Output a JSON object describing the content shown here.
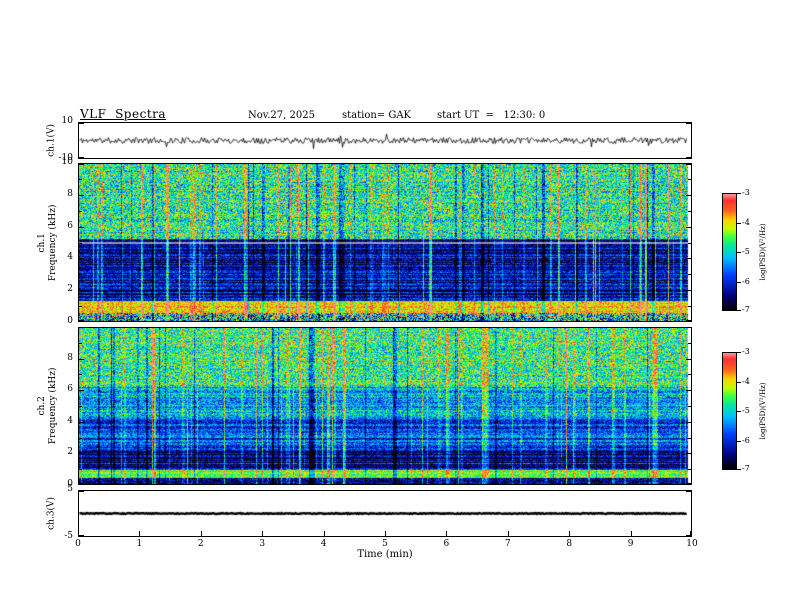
{
  "header": {
    "title": "VLF  Spectra",
    "date": "Nov.27, 2025",
    "station_label": "station= GAK",
    "start_ut_label": "start UT  =   12:30: 0"
  },
  "xaxis": {
    "label": "Time  (min)",
    "ticks": [
      0,
      1,
      2,
      3,
      4,
      5,
      6,
      7,
      8,
      9,
      10
    ],
    "lim": [
      0,
      10
    ]
  },
  "colorbar": {
    "label": "log(PSD)(V²/Hz)",
    "ticks": [
      -3,
      -4,
      -5,
      -6,
      -7
    ],
    "lim": [
      -7,
      -3
    ]
  },
  "colormap": {
    "lim": [
      -7,
      -3
    ],
    "stops": [
      [
        0.0,
        "#000000"
      ],
      [
        0.12,
        "#000080"
      ],
      [
        0.3,
        "#0040ff"
      ],
      [
        0.45,
        "#00c0ff"
      ],
      [
        0.55,
        "#00e8a0"
      ],
      [
        0.63,
        "#40ff40"
      ],
      [
        0.7,
        "#c0ff00"
      ],
      [
        0.78,
        "#ffd000"
      ],
      [
        0.86,
        "#ff6020"
      ],
      [
        0.95,
        "#ff3030"
      ],
      [
        1.0,
        "#ff9090"
      ]
    ]
  },
  "chart_data": [
    {
      "type": "line",
      "name": "ch1_waveform",
      "ylabel": "ch.1(V)",
      "ylim": [
        -10,
        10
      ],
      "yticks": [
        10,
        -10
      ],
      "xlim": [
        0,
        10
      ],
      "description": "Broadband noisy voltage waveform centered on 0 V, typical excursions of a few volts with sparse impulsive spikes",
      "render": {
        "seed": 11,
        "amp": 1.7,
        "spike_p": 0.012,
        "spike_amp": 5.5,
        "linewidth": 0.8
      }
    },
    {
      "type": "heatmap",
      "name": "ch1_spectrogram",
      "ylabel_line1": "ch.1",
      "ylabel_line2": "Frequency (kHz)",
      "ylim": [
        0,
        10
      ],
      "yticks": [
        10,
        8,
        6,
        4,
        2,
        0
      ],
      "xlim": [
        0,
        10
      ],
      "value_lim": [
        -7,
        -3
      ],
      "description": "PSD vs time: speckled green/yellow noise above ~5 kHz, dark blue band 1.5-5 kHz crossed by vertical impulsive sferic streaks, bright red/yellow horizontal band near 0.5-1.2 kHz, faint light line near 5 kHz",
      "render": {
        "seed": 21,
        "white_line_khz": 4.95,
        "bands": [
          {
            "f": [
              5.2,
              10
            ],
            "base": -4.8,
            "noise": 0.95,
            "stripe": 0.25
          },
          {
            "f": [
              1.25,
              5.2
            ],
            "base": -6.35,
            "noise": 0.6,
            "stripe": 0.55
          },
          {
            "f": [
              0.5,
              1.25
            ],
            "base": -3.9,
            "noise": 0.5,
            "stripe": 0.2
          },
          {
            "f": [
              0,
              0.5
            ],
            "base": -5.2,
            "noise": 1.7,
            "stripe": 0.4
          }
        ],
        "streaks": {
          "p_strong": 0.025,
          "strong": 2.0,
          "p_bright": 0.09,
          "bright": 1.15,
          "p_dark": 0.05,
          "dark": -0.95
        }
      }
    },
    {
      "type": "heatmap",
      "name": "ch2_spectrogram",
      "ylabel_line1": "ch.2",
      "ylabel_line2": "Frequency (kHz)",
      "ylim": [
        0,
        10
      ],
      "yticks": [
        8,
        6,
        4,
        2,
        0
      ],
      "xlim": [
        0,
        10
      ],
      "value_lim": [
        -7,
        -3
      ],
      "description": "PSD vs time: green/yellow speckle above ~6 kHz, cyan-green speckle 2-6 kHz, blue striped band below 2 kHz, bright yellow-green band near 0.4-0.9 kHz, occasional dark vertical streaks",
      "render": {
        "seed": 37,
        "white_line_khz": null,
        "bands": [
          {
            "f": [
              6.2,
              10
            ],
            "base": -4.7,
            "noise": 0.9,
            "stripe": 0.2
          },
          {
            "f": [
              4.3,
              6.2
            ],
            "base": -5.3,
            "noise": 0.75,
            "stripe": 0.35
          },
          {
            "f": [
              2.1,
              4.3
            ],
            "base": -5.8,
            "noise": 0.65,
            "stripe": 0.5
          },
          {
            "f": [
              0.85,
              2.1
            ],
            "base": -6.3,
            "noise": 0.55,
            "stripe": 0.6
          },
          {
            "f": [
              0.35,
              0.85
            ],
            "base": -4.5,
            "noise": 0.5,
            "stripe": 0.3
          },
          {
            "f": [
              0,
              0.35
            ],
            "base": -6.6,
            "noise": 0.8,
            "stripe": 0.3
          }
        ],
        "streaks": {
          "p_strong": 0.02,
          "strong": 1.8,
          "p_bright": 0.08,
          "bright": 1.0,
          "p_dark": 0.05,
          "dark": -1.1
        }
      }
    },
    {
      "type": "line",
      "name": "ch3_waveform",
      "ylabel": "ch.3(V)",
      "ylim": [
        -5,
        5
      ],
      "yticks": [
        5,
        -5
      ],
      "xlim": [
        0,
        10
      ],
      "description": "Flat thick trace at 0 V for the whole interval (channel inactive)",
      "render": {
        "seed": 31,
        "amp": 0.1,
        "spike_p": 0,
        "spike_amp": 0,
        "linewidth": 2.4
      }
    }
  ]
}
